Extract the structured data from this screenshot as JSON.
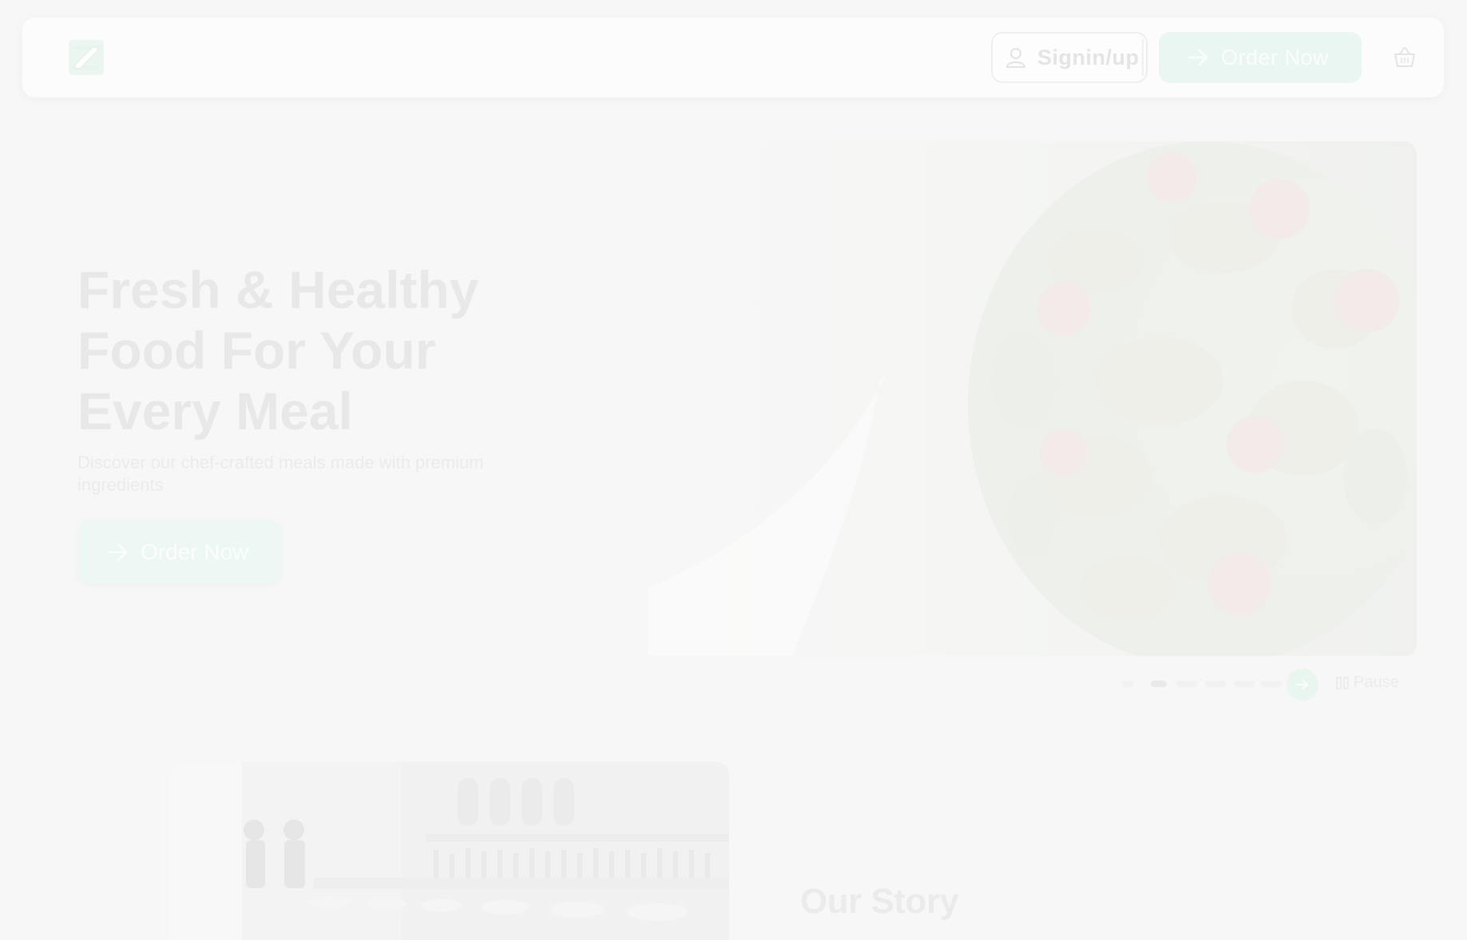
{
  "header": {
    "logo_icon": "z-logo-icon",
    "signin_label": "Signin/up",
    "order_label": "Order Now",
    "cart_icon": "basket-icon"
  },
  "hero": {
    "title_lines": [
      "Fresh & Healthy",
      "Food For Your",
      "Every Meal"
    ],
    "subtitle": "Discover our chef-crafted meals made with premium ingredients",
    "order_label": "Order Now"
  },
  "carousel": {
    "active_index": 1,
    "slide_count": 6,
    "next_icon": "arrow-right-icon",
    "pause_icon": "pause-icon",
    "pause_label": "Pause"
  },
  "story": {
    "title": "Our Story"
  },
  "colors": {
    "accent": "#e9f6f1",
    "background": "#f7f7f7"
  }
}
